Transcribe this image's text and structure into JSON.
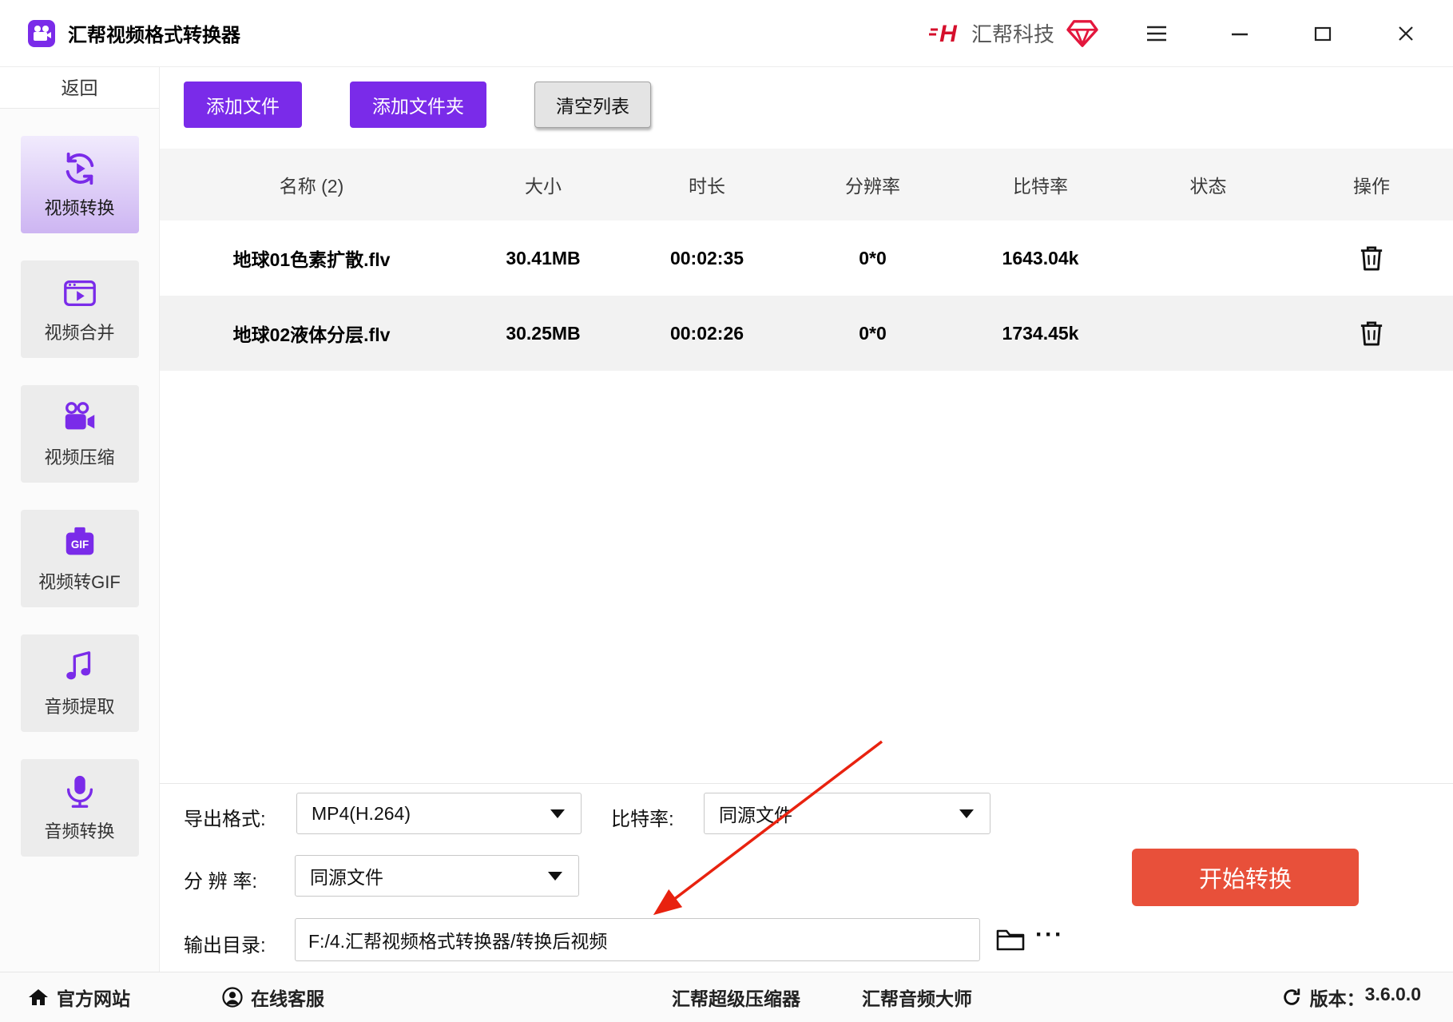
{
  "titlebar": {
    "app_title": "汇帮视频格式转换器",
    "brand_name": "汇帮科技"
  },
  "sidebar": {
    "back_label": "返回",
    "items": [
      {
        "label": "视频转换",
        "active": true
      },
      {
        "label": "视频合并",
        "active": false
      },
      {
        "label": "视频压缩",
        "active": false
      },
      {
        "label": "视频转GIF",
        "active": false
      },
      {
        "label": "音频提取",
        "active": false
      },
      {
        "label": "音频转换",
        "active": false
      }
    ]
  },
  "toolbar": {
    "add_file_label": "添加文件",
    "add_folder_label": "添加文件夹",
    "clear_list_label": "清空列表"
  },
  "table": {
    "headers": {
      "name": "名称 (2)",
      "size": "大小",
      "duration": "时长",
      "resolution": "分辨率",
      "bitrate": "比特率",
      "status": "状态",
      "action": "操作"
    },
    "rows": [
      {
        "name": "地球01色素扩散.flv",
        "size": "30.41MB",
        "duration": "00:02:35",
        "resolution": "0*0",
        "bitrate": "1643.04k"
      },
      {
        "name": "地球02液体分层.flv",
        "size": "30.25MB",
        "duration": "00:02:26",
        "resolution": "0*0",
        "bitrate": "1734.45k"
      }
    ]
  },
  "settings": {
    "export_format_label": "导出格式:",
    "export_format_value": "MP4(H.264)",
    "bitrate_label": "比特率:",
    "bitrate_value": "同源文件",
    "resolution_label": "分 辨 率:",
    "resolution_value": "同源文件",
    "output_dir_label": "输出目录:",
    "output_dir_value": "F:/4.汇帮视频格式转换器/转换后视频",
    "more_dots": "···",
    "start_label": "开始转换"
  },
  "statusbar": {
    "official_site": "官方网站",
    "online_support": "在线客服",
    "super_compressor": "汇帮超级压缩器",
    "audio_master": "汇帮音频大师",
    "version_label": "版本：",
    "version_value": "3.6.0.0"
  },
  "colors": {
    "accent_purple": "#7A2BE9",
    "start_red": "#E8503A",
    "progress_pink": "#F2A5C0",
    "brand_red": "#D50F2C",
    "gem_red": "#E3173D",
    "annotation_red": "#E8220F"
  }
}
